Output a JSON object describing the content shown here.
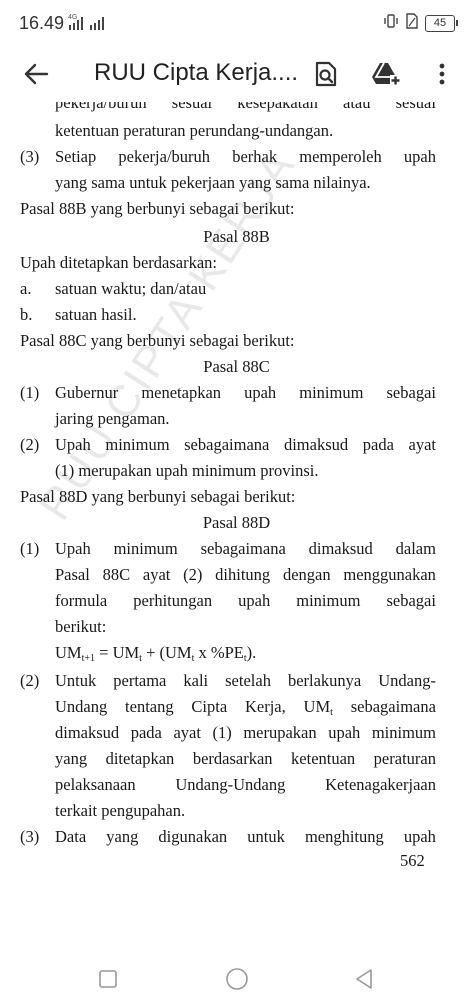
{
  "status_bar": {
    "time": "16.49",
    "network": "4G",
    "battery": "45"
  },
  "app_bar": {
    "title": "RUU Cipta Kerja...."
  },
  "watermark": "RUU CIPTA KERJA",
  "document": {
    "cut_line": "pekerja/buruh sesuai kesepakatan atau sesuai",
    "line_01": "ketentuan peraturan perundang-undangan.",
    "item3_num": "(3)",
    "line_02": "Setiap pekerja/buruh berhak memperoleh upah",
    "line_03": "yang sama untuk pekerjaan yang sama nilainya.",
    "line_04": "Pasal 88B yang berbunyi sebagai berikut:",
    "line_05": "Pasal 88B",
    "line_06": "Upah ditetapkan berdasarkan:",
    "a_label": "a.",
    "a_text": "satuan waktu; dan/atau",
    "b_label": "b.",
    "b_text": "satuan hasil.",
    "line_07": "Pasal 88C yang berbunyi sebagai berikut:",
    "line_08": "Pasal 88C",
    "c1_num": "(1)",
    "c1_l1": "Gubernur menetapkan upah minimum sebagai",
    "c1_l2": "jaring pengaman.",
    "c2_num": "(2)",
    "c2_l1": "Upah minimum sebagaimana dimaksud pada ayat",
    "c2_l2": "(1) merupakan upah minimum provinsi.",
    "line_09": "Pasal 88D yang berbunyi sebagai berikut:",
    "line_10": "Pasal 88D",
    "d1_num": "(1)",
    "d1_l1": "Upah minimum sebagaimana dimaksud dalam",
    "d1_l2": "Pasal 88C ayat (2) dihitung dengan menggunakan",
    "d1_l3": "formula perhitungan upah minimum sebagai",
    "d1_l4": "berikut:",
    "formula": {
      "p1": "UM",
      "s1": "t+1",
      "p2": " = UM",
      "s2": "t",
      "p3": " + (UM",
      "s3": "t",
      "p4": " x %PE",
      "s4": "t",
      "p5": ")."
    },
    "d2_num": "(2)",
    "d2_l1": "Untuk pertama kali setelah berlakunya Undang-",
    "d2_l2_a": "Undang tentang Cipta Kerja, UM",
    "d2_l2_sub": "t",
    "d2_l2_b": " sebagaimana",
    "d2_l3": "dimaksud pada ayat (1) merupakan upah minimum",
    "d2_l4": "yang ditetapkan berdasarkan ketentuan peraturan",
    "d2_l5": "pelaksanaan Undang-Undang Ketenagakerjaan",
    "d2_l6": "terkait pengupahan.",
    "d3_num": "(3)",
    "d3_l1": "Data yang digunakan untuk menghitung upah",
    "page_number": "562"
  }
}
